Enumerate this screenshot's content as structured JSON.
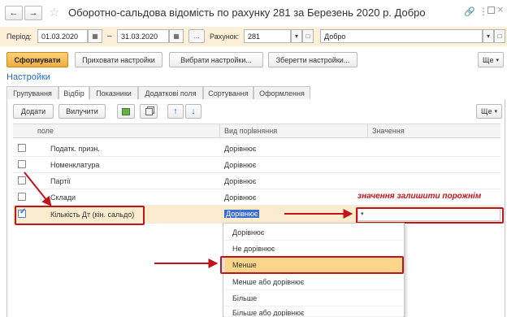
{
  "window": {
    "title": "Оборотно-сальдова відомість по рахунку 281 за Березень 2020 р. Добро",
    "back_icon": "arrow-left",
    "forward_icon": "arrow-right",
    "favorite_icon": "star",
    "link_icon": "link",
    "menu_icon": "vertical-dots",
    "restore_icon": "restore",
    "close_icon": "close"
  },
  "params": {
    "period_label": "Період:",
    "date_from": "01.03.2020",
    "dash": "–",
    "date_to": "31.03.2020",
    "dots_button": "...",
    "account_label": "Рахунок:",
    "account_value": "281",
    "org_value": "Добро"
  },
  "toolbar": {
    "generate": "Сформувати",
    "hide_settings": "Приховати настройки",
    "choose_settings": "Вибрати настройки...",
    "save_settings": "Зберегти настройки...",
    "more": "Ще"
  },
  "settings_title": "Настройки",
  "tabs": [
    "Групування",
    "Відбір",
    "Показники",
    "Додаткові поля",
    "Сортування",
    "Оформлення"
  ],
  "active_tab": "Відбір",
  "filter_toolbar": {
    "add": "Додати",
    "remove": "Вилучити",
    "more": "Ще"
  },
  "columns": {
    "field": "поле",
    "comparison": "Вид порівняння",
    "value": "Значення"
  },
  "rows": [
    {
      "field": "Податк. призн.",
      "comparison": "Дорівнює",
      "checked": false
    },
    {
      "field": "Номенклатура",
      "comparison": "Дорівнює",
      "checked": false
    },
    {
      "field": "Партії",
      "comparison": "Дорівнює",
      "checked": false
    },
    {
      "field": "Склади",
      "comparison": "Дорівнює",
      "checked": false
    },
    {
      "field": "Кількість Дт (кін. сальдо)",
      "comparison": "Дорівнює",
      "checked": true
    }
  ],
  "annotation": "значення залишити порожнім",
  "dropdown_options": [
    "Дорівнює",
    "Не дорівнює",
    "Менше",
    "Менше або дорівнює",
    "Більше",
    "Більше або дорівнює"
  ],
  "dropdown_selected": "Менше",
  "colors": {
    "accent_orange": "#f5b041",
    "highlight_row": "#fbeccd",
    "red_annotation": "#c0141c",
    "link_blue": "#1f6bc7",
    "params_bg": "#fcf0d8"
  }
}
